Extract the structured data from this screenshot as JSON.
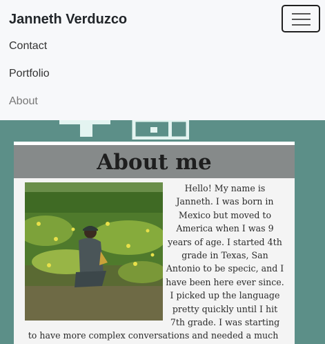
{
  "navbar": {
    "brand": "Janneth Verduzco",
    "links": [
      {
        "label": "Contact"
      },
      {
        "label": "Portfolio"
      },
      {
        "label": "About"
      }
    ]
  },
  "about": {
    "title": "About me",
    "bio": "Hello! My name is Janneth. I was born in Mexico but moved to America when I was 9 years of age. I started 4th grade in Texas, San Antonio to be specic, and I have been here ever since. I picked up the language pretty quickly until I hit 7th grade. I was starting to have more complex conversations and needed a much larger vocabulary. I soon got over that hump becuase I"
  },
  "colors": {
    "page_background": "#5c8f88",
    "navbar_background": "#f7f8fa",
    "card_header": "#868a8a"
  }
}
